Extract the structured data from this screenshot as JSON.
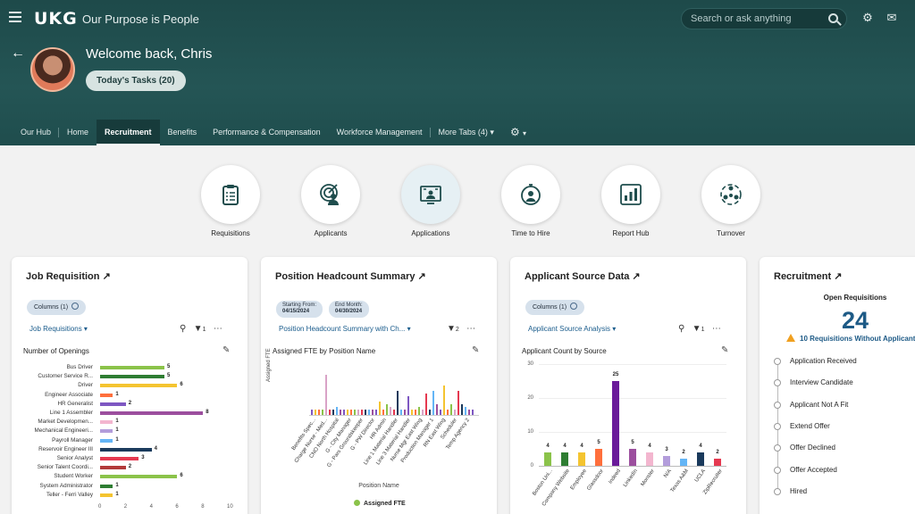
{
  "header": {
    "logo": "UKG",
    "tagline": "Our Purpose is People",
    "search_placeholder": "Search or ask anything",
    "welcome": "Welcome back, Chris",
    "tasks_button": "Today's Tasks (20)"
  },
  "tabs": [
    {
      "label": "Our Hub"
    },
    {
      "label": "Home"
    },
    {
      "label": "Recruitment",
      "active": true
    },
    {
      "label": "Benefits"
    },
    {
      "label": "Performance & Compensation"
    },
    {
      "label": "Workforce Management"
    },
    {
      "label": "More Tabs  (4)"
    }
  ],
  "quick_links": [
    {
      "label": "Requisitions",
      "icon": "clipboard-list-icon"
    },
    {
      "label": "Applicants",
      "icon": "applicant-target-icon"
    },
    {
      "label": "Applications",
      "icon": "applications-screen-icon"
    },
    {
      "label": "Time to Hire",
      "icon": "stopwatch-icon"
    },
    {
      "label": "Report Hub",
      "icon": "bar-report-icon"
    },
    {
      "label": "Turnover",
      "icon": "people-cycle-icon"
    }
  ],
  "job_requisition": {
    "title": "Job Requisition",
    "columns_chip": "Columns (1)",
    "dropdown": "Job Requisitions",
    "filter_count": "1",
    "chart_title": "Number of Openings",
    "xticks": [
      "0",
      "2",
      "4",
      "6",
      "8",
      "10"
    ]
  },
  "headcount": {
    "title": "Position Headcount Summary",
    "starting_label": "Starting From:",
    "starting_value": "04/15/2024",
    "end_label": "End Month:",
    "end_value": "04/30/2024",
    "dropdown": "Position Headcount Summary with Ch...",
    "filter_count": "2",
    "chart_title": "Assigned FTE by Position Name",
    "ylabel": "Assigned FTE",
    "xlabel": "Position Name",
    "legend": "Assigned FTE",
    "categories": [
      "Benefits Spec...",
      "Charge Nurse - Med...",
      "CNO North Hospital",
      "G - City Manager",
      "G - Pars Groundskeeper",
      "G - PW Director",
      "HR Admin",
      "Line 1 Material Handler",
      "Line 3 Material Handler",
      "Nurse Mgr East Wing",
      "Production Manager 1",
      "RN East Wing",
      "Scheduler",
      "Temp Agency 2"
    ]
  },
  "applicant_source": {
    "title": "Applicant Source Data",
    "columns_chip": "Columns (1)",
    "dropdown": "Applicant Source Analysis",
    "filter_count": "1",
    "chart_title": "Applicant Count by Source",
    "yticks": [
      "0",
      "10",
      "20",
      "30"
    ]
  },
  "recruitment": {
    "title": "Recruitment",
    "subtitle": "Open Requisitions",
    "count": "24",
    "warning": "10 Requisitions Without Applicants",
    "stages": [
      "Application Received",
      "Interview Candidate",
      "Applicant Not A Fit",
      "Extend Offer",
      "Offer Declined",
      "Offer Accepted",
      "Hired"
    ]
  },
  "chart_data": [
    {
      "type": "bar",
      "orientation": "horizontal",
      "title": "Number of Openings",
      "categories": [
        "Bus Driver",
        "Customer Service R...",
        "Driver",
        "Engineer Associate",
        "HR Generalist",
        "Line 1 Assembler",
        "Market Developmen...",
        "Mechanical Engineeri...",
        "Payroll Manager",
        "Reservoir Engineer III",
        "Senior Analyst",
        "Senior Talent Coordi...",
        "Student Worker",
        "System Administrator",
        "Teller - Ferri Valley"
      ],
      "values": [
        5,
        5,
        6,
        1,
        2,
        8,
        1,
        1,
        1,
        4,
        3,
        2,
        6,
        1,
        1
      ],
      "colors": [
        "#8bc34a",
        "#2e7d32",
        "#f4c430",
        "#ff6f3c",
        "#7e57c2",
        "#9c4f9e",
        "#f3b6cf",
        "#b39ddb",
        "#64b5f6",
        "#1a3a5c",
        "#e53950",
        "#b23a3a",
        "#8bc34a",
        "#2e7d32",
        "#f4c430"
      ],
      "xlim": [
        0,
        10
      ]
    },
    {
      "type": "bar",
      "title": "Assigned FTE by Position Name",
      "xlabel": "Position Name",
      "ylabel": "Assigned FTE",
      "series": [
        {
          "name": "Assigned FTE"
        }
      ],
      "values": [
        1,
        1,
        1,
        1,
        7.5,
        1,
        1,
        1.5,
        1,
        1,
        1,
        1,
        1,
        1,
        1,
        1,
        1,
        1,
        1,
        2.5,
        1,
        2,
        1.5,
        1,
        4.5,
        1,
        1,
        3.5,
        1,
        1,
        1.5,
        1,
        4,
        1,
        4.5,
        2,
        1,
        5.5,
        1,
        2,
        1,
        4.5,
        2,
        1.5,
        1,
        1
      ],
      "colors": [
        "#7e57c2",
        "#f4c430",
        "#ff6f3c",
        "#8bc34a",
        "#d9a3c7",
        "#e53950",
        "#1a3a5c",
        "#64b5f6",
        "#9c4f9e"
      ]
    },
    {
      "type": "bar",
      "title": "Applicant Count by Source",
      "categories": [
        "Boston Uni...",
        "Company Website",
        "Employee",
        "Glassdoor",
        "Indeed",
        "LinkedIn",
        "Monster",
        "N/A",
        "Texas A&M",
        "UCLA",
        "ZipRecruiter"
      ],
      "values": [
        4,
        4,
        4,
        5,
        25,
        5,
        4,
        3,
        2,
        4,
        2
      ],
      "colors": [
        "#8bc34a",
        "#2e7d32",
        "#f4c430",
        "#ff6f3c",
        "#6a1b9a",
        "#9c4f9e",
        "#f3b6cf",
        "#b39ddb",
        "#64b5f6",
        "#1a3a5c",
        "#e53950"
      ],
      "ylim": [
        0,
        30
      ]
    }
  ]
}
